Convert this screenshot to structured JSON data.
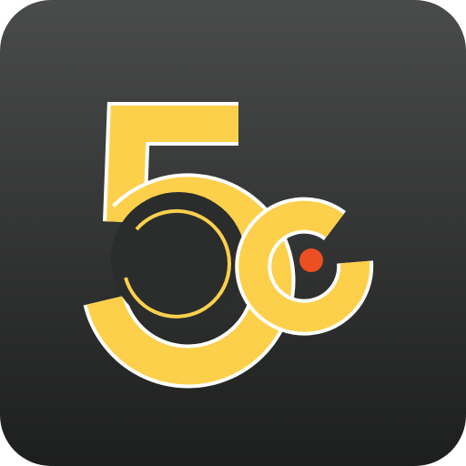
{
  "app_icon": {
    "logo_text": "5C",
    "colors": {
      "background_top": "#4a4b4b",
      "background_bottom": "#1d1e1e",
      "logo_yellow": "#fdd04c",
      "accent_dot": "#ec4f22",
      "outline_white": "#ffffff"
    }
  }
}
